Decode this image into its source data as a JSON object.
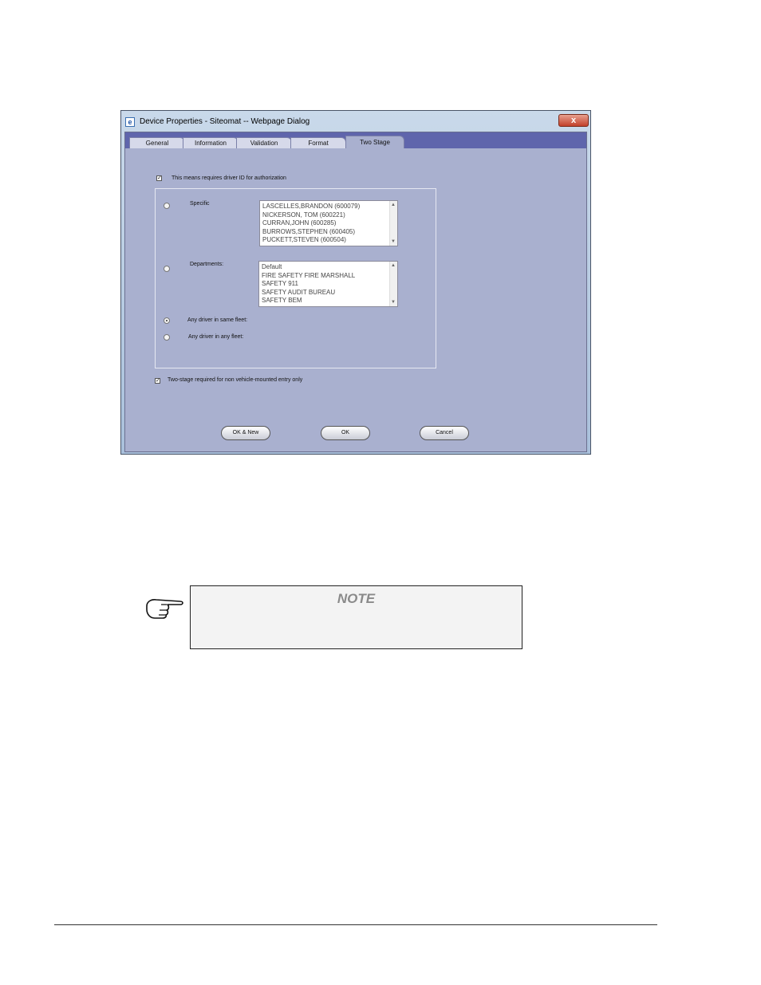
{
  "dialog": {
    "title": "Device Properties - Siteomat -- Webpage Dialog",
    "close_label": "x",
    "icon_label": "e"
  },
  "tabs": [
    {
      "label": "General",
      "active": false
    },
    {
      "label": "Information",
      "active": false
    },
    {
      "label": "Validation",
      "active": false
    },
    {
      "label": "Format",
      "active": false
    },
    {
      "label": "Two Stage",
      "active": true
    }
  ],
  "form": {
    "require_driver_id": {
      "label": "This means requires driver ID for authorization",
      "checked": true
    },
    "specific": {
      "label": "Specific",
      "selected": false,
      "items": [
        "LASCELLES,BRANDON (600079)",
        "NICKERSON, TOM (600221)",
        "CURRAN,JOHN (600285)",
        "BURROWS,STEPHEN (600405)",
        "PUCKETT,STEVEN (600504)"
      ]
    },
    "departments": {
      "label": "Departments:",
      "selected": false,
      "items": [
        "Default",
        "FIRE SAFETY FIRE MARSHALL",
        "SAFETY 911",
        "SAFETY AUDIT BUREAU",
        "SAFETY BEM"
      ]
    },
    "any_same_fleet": {
      "label": "Any driver in same fleet:",
      "selected": true
    },
    "any_fleet": {
      "label": "Any driver in any fleet:",
      "selected": false
    },
    "two_stage_non_vehicle": {
      "label": "Two-stage required for non vehicle-mounted entry only",
      "checked": true
    }
  },
  "buttons": {
    "ok_new": "OK & New",
    "ok": "OK",
    "cancel": "Cancel"
  },
  "note": {
    "title": "NOTE"
  },
  "colors": {
    "tabstrip": "#5f65ac",
    "client_bg": "#a9b0cf"
  }
}
